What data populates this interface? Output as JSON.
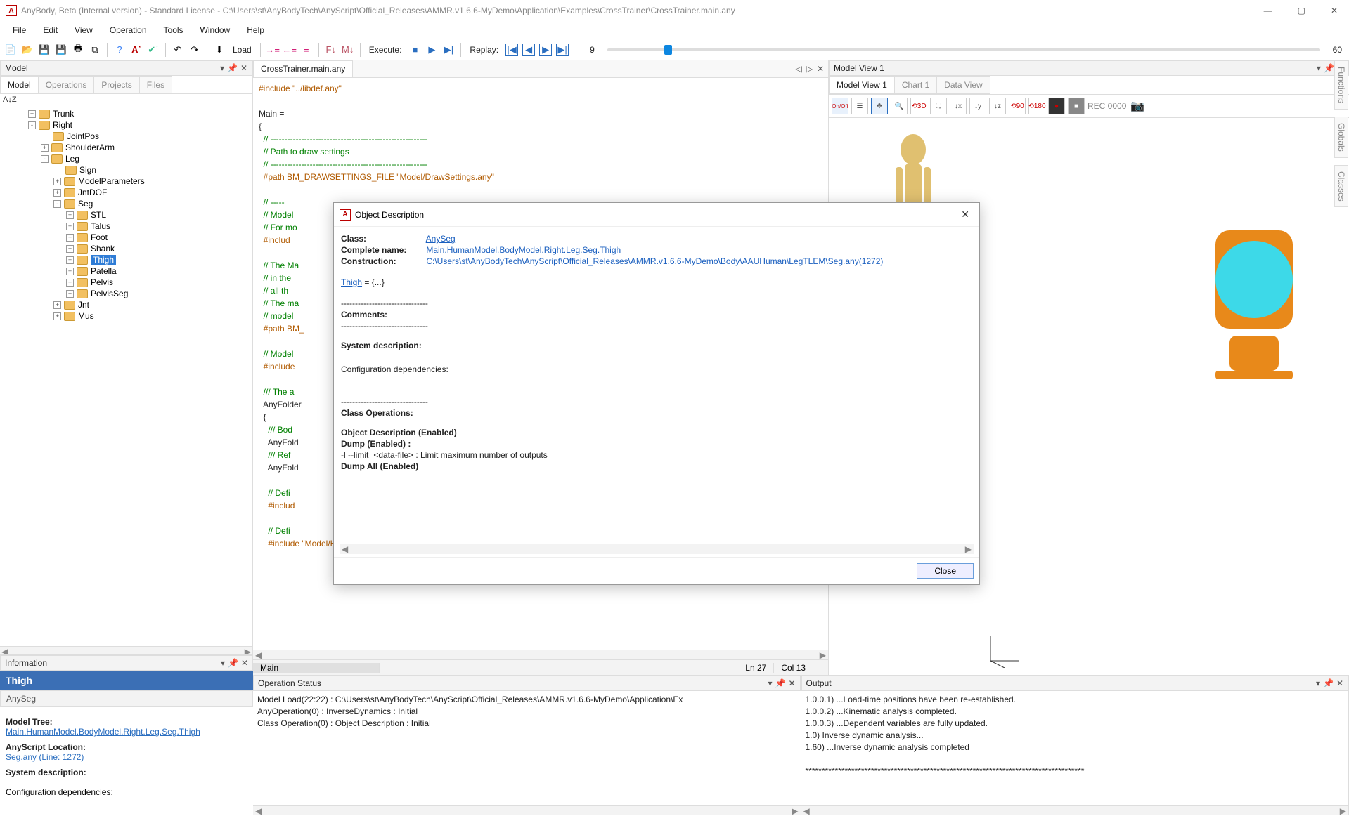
{
  "titlebar": {
    "text": "AnyBody, Beta (Internal version)  -  Standard License  -  C:\\Users\\st\\AnyBodyTech\\AnyScript\\Official_Releases\\AMMR.v1.6.6-MyDemo\\Application\\Examples\\CrossTrainer\\CrossTrainer.main.any"
  },
  "menubar": [
    "File",
    "Edit",
    "View",
    "Operation",
    "Tools",
    "Window",
    "Help"
  ],
  "toolbar": {
    "load": "Load",
    "execute": "Execute:",
    "replay": "Replay:",
    "start": "9",
    "end": "60"
  },
  "model_panel": {
    "title": "Model",
    "tabs": [
      "Model",
      "Operations",
      "Projects",
      "Files"
    ],
    "active_tab": 0,
    "sort_label": "A↓Z",
    "tree": [
      {
        "indent": 1,
        "exp": "+",
        "label": "Trunk"
      },
      {
        "indent": 1,
        "exp": "-",
        "label": "Right"
      },
      {
        "indent": 2,
        "exp": "",
        "label": "JointPos"
      },
      {
        "indent": 2,
        "exp": "+",
        "label": "ShoulderArm"
      },
      {
        "indent": 2,
        "exp": "-",
        "label": "Leg"
      },
      {
        "indent": 3,
        "exp": "",
        "label": "Sign"
      },
      {
        "indent": 3,
        "exp": "+",
        "label": "ModelParameters"
      },
      {
        "indent": 3,
        "exp": "+",
        "label": "JntDOF"
      },
      {
        "indent": 3,
        "exp": "-",
        "label": "Seg"
      },
      {
        "indent": 4,
        "exp": "+",
        "label": "STL"
      },
      {
        "indent": 4,
        "exp": "+",
        "label": "Talus"
      },
      {
        "indent": 4,
        "exp": "+",
        "label": "Foot"
      },
      {
        "indent": 4,
        "exp": "+",
        "label": "Shank"
      },
      {
        "indent": 4,
        "exp": "+",
        "label": "Thigh",
        "selected": true
      },
      {
        "indent": 4,
        "exp": "+",
        "label": "Patella"
      },
      {
        "indent": 4,
        "exp": "+",
        "label": "Pelvis"
      },
      {
        "indent": 4,
        "exp": "+",
        "label": "PelvisSeg"
      },
      {
        "indent": 3,
        "exp": "+",
        "label": "Jnt"
      },
      {
        "indent": 3,
        "exp": "+",
        "label": "Mus"
      }
    ]
  },
  "information_panel": {
    "title": "Information",
    "header": "Thigh",
    "class_link": "AnySeg",
    "model_tree_lbl": "Model Tree:",
    "model_tree_link": "Main.HumanModel.BodyModel.Right.Leg.Seg.Thigh",
    "anyscript_lbl": "AnyScript Location:",
    "anyscript_link": "Seg.any (Line: 1272)",
    "sysdesc_lbl": "System description:",
    "confdep_lbl": "Configuration dependencies:"
  },
  "editor": {
    "tab": "CrossTrainer.main.any",
    "status_main": "Main",
    "status_ln": "Ln 27",
    "status_col": "Col 13",
    "code_lines": [
      {
        "t": "dir",
        "s": "#include \"../libdef.any\""
      },
      {
        "t": "",
        "s": ""
      },
      {
        "t": "key",
        "s": "Main ="
      },
      {
        "t": "key",
        "s": "{"
      },
      {
        "t": "cmt",
        "s": "  // --------------------------------------------------------"
      },
      {
        "t": "cmt",
        "s": "  // Path to draw settings"
      },
      {
        "t": "cmt",
        "s": "  // --------------------------------------------------------"
      },
      {
        "t": "dir",
        "s": "  #path BM_DRAWSETTINGS_FILE \"Model/DrawSettings.any\""
      },
      {
        "t": "",
        "s": ""
      },
      {
        "t": "cmt",
        "s": "  // -----"
      },
      {
        "t": "cmt",
        "s": "  // Model "
      },
      {
        "t": "cmt",
        "s": "  // For mo"
      },
      {
        "t": "dir",
        "s": "  #includ"
      },
      {
        "t": "",
        "s": ""
      },
      {
        "t": "cmt",
        "s": "  // The Ma"
      },
      {
        "t": "cmt",
        "s": "  // in the"
      },
      {
        "t": "cmt",
        "s": "  // all th"
      },
      {
        "t": "cmt",
        "s": "  // The ma"
      },
      {
        "t": "cmt",
        "s": "  // model "
      },
      {
        "t": "dir",
        "s": "  #path BM_"
      },
      {
        "t": "",
        "s": ""
      },
      {
        "t": "cmt",
        "s": "  // Model "
      },
      {
        "t": "dir",
        "s": "  #include "
      },
      {
        "t": "",
        "s": ""
      },
      {
        "t": "cmt",
        "s": "  /// The a"
      },
      {
        "t": "key",
        "s": "  AnyFolder"
      },
      {
        "t": "key",
        "s": "  {"
      },
      {
        "t": "cmt",
        "s": "    /// Bod"
      },
      {
        "t": "key",
        "s": "    AnyFold"
      },
      {
        "t": "cmt",
        "s": "    /// Ref"
      },
      {
        "t": "key",
        "s": "    AnyFold"
      },
      {
        "t": "",
        "s": ""
      },
      {
        "t": "cmt",
        "s": "    // Defi"
      },
      {
        "t": "dir",
        "s": "    #includ"
      },
      {
        "t": "",
        "s": ""
      },
      {
        "t": "cmt",
        "s": "    // Defi"
      },
      {
        "t": "dir",
        "s": "    #include \"Model/HumanRefNodes.any\""
      }
    ]
  },
  "model_view": {
    "title": "Model View 1",
    "tabs": [
      "Model View 1",
      "Chart 1",
      "Data View"
    ],
    "active_tab": 0,
    "rec_label": "REC  0000",
    "onoff": "On/Off"
  },
  "op_status": {
    "title": "Operation Status",
    "lines": [
      "Model Load(22:22) : C:\\Users\\st\\AnyBodyTech\\AnyScript\\Official_Releases\\AMMR.v1.6.6-MyDemo\\Application\\Ex",
      "AnyOperation(0) : InverseDynamics : Initial",
      "Class Operation(0) : Object Description : Initial"
    ]
  },
  "output": {
    "title": "Output",
    "lines": [
      "1.0.0.1) ...Load-time positions have been re-established.",
      "1.0.0.2) ...Kinematic analysis completed.",
      "1.0.0.3) ...Dependent variables are fully updated.",
      "1.0) Inverse dynamic analysis...",
      "1.60) ...Inverse dynamic analysis completed",
      "",
      "*************************************************************************************"
    ]
  },
  "vert_tabs": [
    "Functions",
    "Globals",
    "Classes"
  ],
  "dialog": {
    "title": "Object Description",
    "class_lbl": "Class:",
    "class_link": "AnySeg",
    "cname_lbl": "Complete name:",
    "cname_link": "Main.HumanModel.BodyModel.Right.Leg.Seg.Thigh",
    "constr_lbl": "Construction:",
    "constr_link": "C:\\Users\\st\\AnyBodyTech\\AnyScript\\Official_Releases\\AMMR.v1.6.6-MyDemo\\Body\\AAUHuman\\LegTLEM\\Seg.any(1272)",
    "thigh_link": "Thigh",
    "thigh_rest": " = {...}",
    "divider": "-------------------------------",
    "comments_lbl": "Comments:",
    "sysdesc_lbl": "System description:",
    "confdep": "Configuration dependencies:",
    "classops_lbl": "Class Operations:",
    "objdesc": "Object Description (Enabled)",
    "dump": "Dump (Enabled) :",
    "dump_opt": "            -l --limit=<data-file> :  Limit maximum number of outputs",
    "dumpall": "Dump All (Enabled)",
    "close": "Close"
  }
}
